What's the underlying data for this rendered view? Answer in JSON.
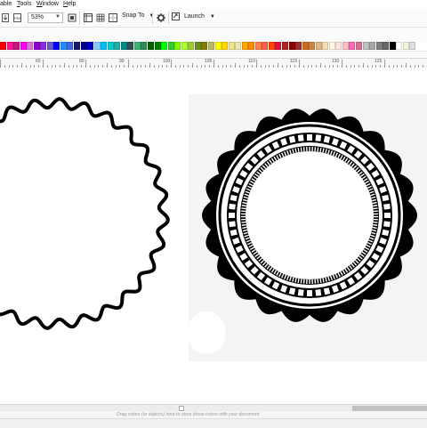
{
  "menu": {
    "items": [
      {
        "prefix": "",
        "underline": "",
        "rest": "able"
      },
      {
        "prefix": "",
        "underline": "T",
        "rest": "ools"
      },
      {
        "prefix": "",
        "underline": "W",
        "rest": "indow"
      },
      {
        "prefix": "",
        "underline": "H",
        "rest": "elp"
      }
    ]
  },
  "toolbar": {
    "zoom_value": "53%",
    "snap_label": "Snap To",
    "launch_label": "Launch",
    "pdf_label": "PDF"
  },
  "ruler": {
    "labels": [
      "60",
      "80",
      "90",
      "100",
      "105",
      "110",
      "115",
      "120",
      "125"
    ]
  },
  "status": {
    "hint": "Drag colors (or objects) here to store these colors with your document"
  },
  "palette": {
    "colors": [
      "#ff0000",
      "#ff1493",
      "#c71585",
      "#ff00ff",
      "#da70d6",
      "#9400d3",
      "#8a2be2",
      "#6a5acd",
      "#0000ff",
      "#1e90ff",
      "#4169e1",
      "#191970",
      "#00008b",
      "#0000cd",
      "#87cefa",
      "#00bfff",
      "#00ced1",
      "#20b2aa",
      "#008b8b",
      "#2f4f4f",
      "#3cb371",
      "#2e8b57",
      "#006400",
      "#008000",
      "#00ff00",
      "#32cd32",
      "#7cfc00",
      "#adff2f",
      "#9acd32",
      "#6b8e23",
      "#808000",
      "#bdb76b",
      "#ffff00",
      "#ffd700",
      "#f0e68c",
      "#eee8aa",
      "#ffa500",
      "#ff8c00",
      "#ff7f50",
      "#ff6347",
      "#ff4500",
      "#dc143c",
      "#b22222",
      "#8b0000",
      "#a52a2a",
      "#d2691e",
      "#cd853f",
      "#deb887",
      "#f5deb3",
      "#fff8dc",
      "#ffe4e1",
      "#ffc0cb",
      "#ff69b4",
      "#db7093",
      "#c0c0c0",
      "#a9a9a9",
      "#808080",
      "#696969",
      "#000000",
      "#ffffff",
      "#f5f5dc",
      "#e0e0e0"
    ]
  }
}
